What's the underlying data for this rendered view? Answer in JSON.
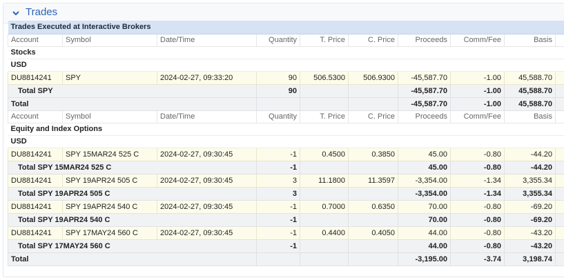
{
  "panel": {
    "title": "Trades"
  },
  "table": {
    "caption": "Trades Executed at Interactive Brokers",
    "columns": [
      "Account",
      "Symbol",
      "Date/Time",
      "Quantity",
      "T. Price",
      "C. Price",
      "Proceeds",
      "Comm/Fee",
      "Basis"
    ],
    "stocks": {
      "section": "Stocks",
      "currency": "USD",
      "trade": [
        "DU8814241",
        "SPY",
        "2024-02-27, 09:33:20",
        "90",
        "506.5300",
        "506.9300",
        "-45,587.70",
        "-1.00",
        "45,588.70"
      ],
      "subtotal": {
        "label": "Total SPY",
        "quantity": "90",
        "proceeds": "-45,587.70",
        "comm": "-1.00",
        "basis": "45,588.70"
      },
      "total": {
        "label": "Total",
        "proceeds": "-45,587.70",
        "comm": "-1.00",
        "basis": "45,588.70"
      }
    },
    "options": {
      "section": "Equity and Index Options",
      "currency": "USD",
      "groups": [
        {
          "trade": [
            "DU8814241",
            "SPY 15MAR24 525 C",
            "2024-02-27, 09:30:45",
            "-1",
            "0.4500",
            "0.3850",
            "45.00",
            "-0.80",
            "-44.20"
          ],
          "subtotal": {
            "label": "Total SPY 15MAR24 525 C",
            "quantity": "-1",
            "proceeds": "45.00",
            "comm": "-0.80",
            "basis": "-44.20"
          }
        },
        {
          "trade": [
            "DU8814241",
            "SPY 19APR24 505 C",
            "2024-02-27, 09:30:45",
            "3",
            "11.1800",
            "11.3597",
            "-3,354.00",
            "-1.34",
            "3,355.34"
          ],
          "subtotal": {
            "label": "Total SPY 19APR24 505 C",
            "quantity": "3",
            "proceeds": "-3,354.00",
            "comm": "-1.34",
            "basis": "3,355.34"
          }
        },
        {
          "trade": [
            "DU8814241",
            "SPY 19APR24 540 C",
            "2024-02-27, 09:30:45",
            "-1",
            "0.7000",
            "0.6350",
            "70.00",
            "-0.80",
            "-69.20"
          ],
          "subtotal": {
            "label": "Total SPY 19APR24 540 C",
            "quantity": "-1",
            "proceeds": "70.00",
            "comm": "-0.80",
            "basis": "-69.20"
          }
        },
        {
          "trade": [
            "DU8814241",
            "SPY 17MAY24 560 C",
            "2024-02-27, 09:30:45",
            "-1",
            "0.4400",
            "0.4050",
            "44.00",
            "-0.80",
            "-43.20"
          ],
          "subtotal": {
            "label": "Total SPY 17MAY24 560 C",
            "quantity": "-1",
            "proceeds": "44.00",
            "comm": "-0.80",
            "basis": "-43.20"
          }
        }
      ],
      "total": {
        "label": "Total",
        "proceeds": "-3,195.00",
        "comm": "-3.74",
        "basis": "3,198.74"
      }
    }
  },
  "colors": {
    "accent": "#2b63b5",
    "caption_bg": "#d6e3f4",
    "trade_bg": "#fdfcea",
    "total_bg": "#f1f2f4"
  },
  "icons": {
    "toggle": "chevron-down-icon"
  }
}
